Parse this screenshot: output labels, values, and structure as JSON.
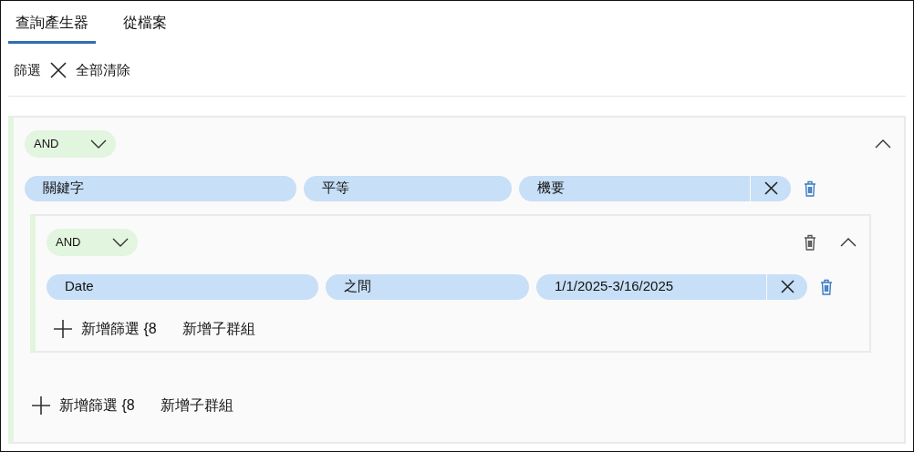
{
  "tabs": [
    {
      "label": "查詢產生器",
      "selected": true
    },
    {
      "label": "從檔案",
      "selected": false
    }
  ],
  "toolbar": {
    "filter_label": "篩選",
    "clear_all": "全部清除"
  },
  "group": {
    "operator": "AND",
    "expanded": true,
    "rows": [
      {
        "field": "關鍵字",
        "operator": "平等",
        "value": "機要"
      }
    ],
    "groups": [
      {
        "operator": "AND",
        "expanded": true,
        "rows": [
          {
            "field": "Date",
            "operator": "之間",
            "value": "1/1/2025-3/16/2025"
          }
        ],
        "add_filter": "新增篩選 {8",
        "add_subgroup": "新增子群組"
      }
    ],
    "add_filter": "新增篩選 {8",
    "add_subgroup": "新增子群組"
  }
}
